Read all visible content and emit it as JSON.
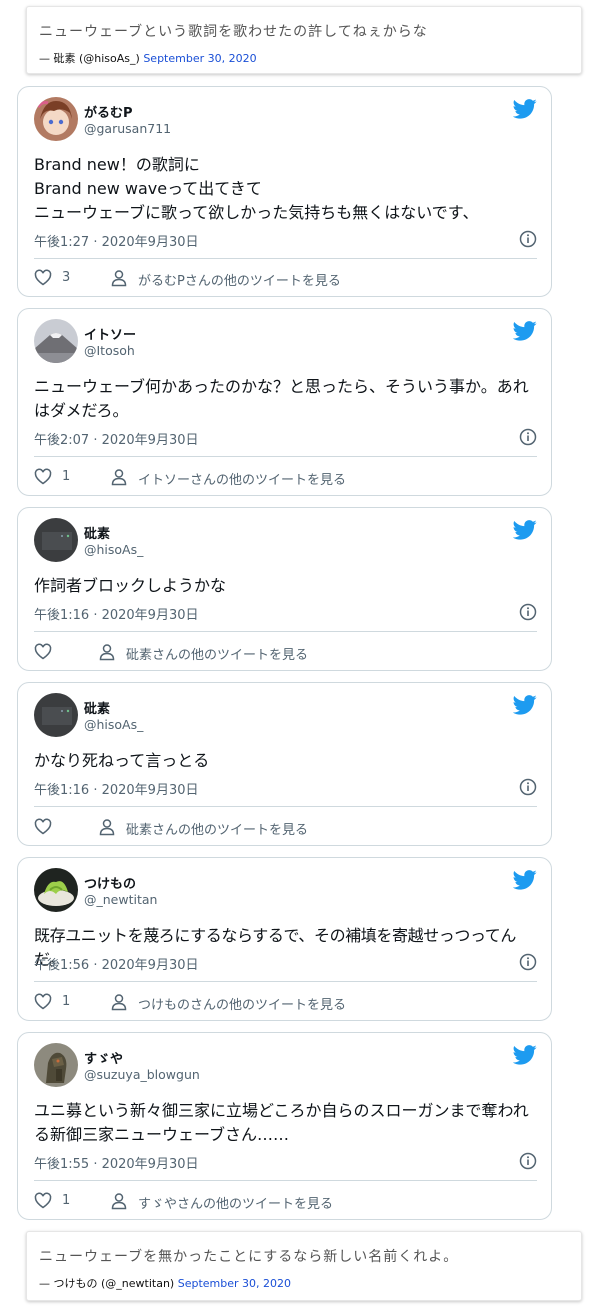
{
  "colors": {
    "link": "#1a4fd6",
    "bird": "#1d9bf0",
    "muted": "#536471",
    "border": "#cfd9de"
  },
  "fallback_top": {
    "text": "ニューウェーブという歌詞を歌わせたの許してねぇからな",
    "author": "— 砒素 (@hisoAs_)",
    "date": "September 30, 2020"
  },
  "fallback_bottom": {
    "text": "ニューウェーブを無かったことにするなら新しい名前くれよ。",
    "author": "— つけもの (@_newtitan)",
    "date": "September 30, 2020"
  },
  "tweets": [
    {
      "name": "がるむP",
      "handle": "@garusan711",
      "text": "Brand new！の歌詞に\nBrand new waveって出てきて\nニューウェーブに歌って欲しかった気持ちも無くはないです、",
      "time": "午後1:27 · 2020年9月30日",
      "likes": "3",
      "more": "がるむPさんの他のツイートを見る",
      "avatar": "anime-avatar"
    },
    {
      "name": "イトソー",
      "handle": "@Itosoh",
      "text": "ニューウェーブ何かあったのかな？と思ったら、そういう事か。あれはダメだろ。",
      "time": "午後2:07 · 2020年9月30日",
      "likes": "1",
      "more": "イトソーさんの他のツイートを見る",
      "avatar": "mountain-avatar"
    },
    {
      "name": "砒素",
      "handle": "@hisoAs_",
      "text": "作詞者ブロックしようかな",
      "time": "午後1:16 · 2020年9月30日",
      "likes": "",
      "more": "砒素さんの他のツイートを見る",
      "avatar": "dark-avatar"
    },
    {
      "name": "砒素",
      "handle": "@hisoAs_",
      "text": "かなり死ねって言っとる",
      "time": "午後1:16 · 2020年9月30日",
      "likes": "",
      "more": "砒素さんの他のツイートを見る",
      "avatar": "dark-avatar"
    },
    {
      "name": "つけもの",
      "handle": "@_newtitan",
      "text": "既存ユニットを蔑ろにするならするで、その補填を寄越せっつってんだ。",
      "time": "午後1:56 · 2020年9月30日",
      "likes": "1",
      "more": "つけものさんの他のツイートを見る",
      "avatar": "food-avatar"
    },
    {
      "name": "すゞや",
      "handle": "@suzuya_blowgun",
      "text": "ユニ募という新々御三家に立場どころか自らのスローガンまで奪われる新御三家ニューウェーブさん……",
      "time": "午後1:55 · 2020年9月30日",
      "likes": "1",
      "more": "すゞやさんの他のツイートを見る",
      "avatar": "robot-avatar"
    }
  ]
}
